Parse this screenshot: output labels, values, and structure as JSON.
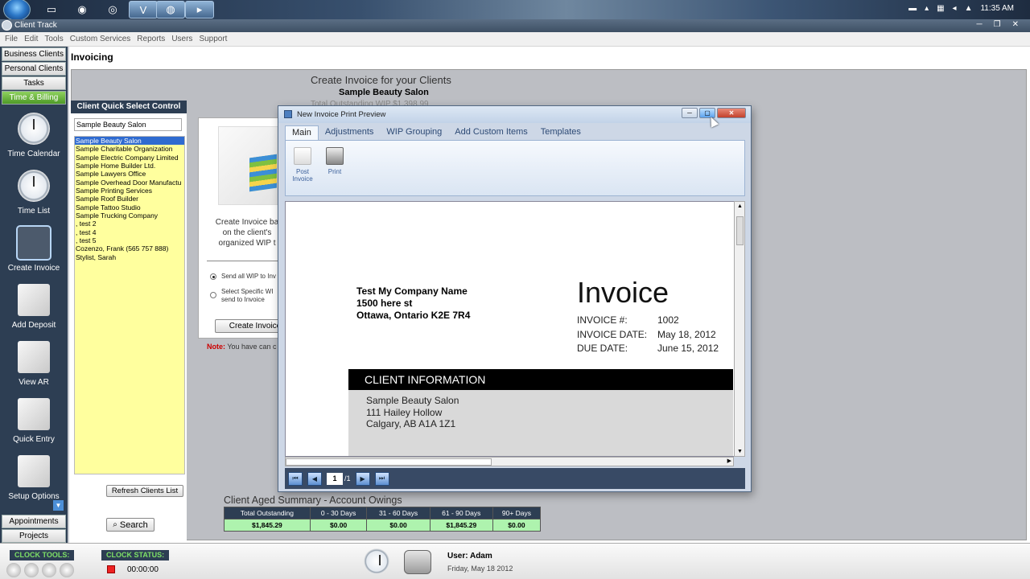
{
  "taskbar": {
    "time": "11:35 AM"
  },
  "app": {
    "title": "Client Track"
  },
  "menu": [
    "File",
    "Edit",
    "Tools",
    "Custom Services",
    "Reports",
    "Users",
    "Support"
  ],
  "nav": {
    "tabs": [
      "Business Clients",
      "Personal Clients",
      "Tasks",
      "Time & Billing"
    ],
    "items": [
      "Time Calendar",
      "Time List",
      "Create Invoice",
      "Add Deposit",
      "View AR",
      "Quick Entry",
      "Setup Options"
    ],
    "bottom_tabs": [
      "Appointments",
      "Projects"
    ]
  },
  "module": {
    "title": "Invoicing"
  },
  "quick_select": {
    "header": "Client Quick Select Control",
    "search_value": "Sample Beauty Salon",
    "clients": [
      "Sample Beauty Salon",
      "Sample Charitable Organization",
      "Sample Electric Company Limited",
      "Sample Home Builder Ltd.",
      "Sample Lawyers Office",
      "Sample Overhead Door Manufactu",
      "Sample Printing Services",
      "Sample Roof Builder",
      "Sample Tattoo Studio",
      "Sample Trucking Company",
      ", test 2",
      ", test 4",
      ", test 5",
      "Cozenzo, Frank (565 757 888)",
      "Stylist, Sarah"
    ],
    "refresh_label": "Refresh Clients List",
    "search_label": "Search"
  },
  "create": {
    "heading": "Create Invoice for your Clients",
    "client": "Sample Beauty Salon",
    "total_wip": "Total Outstanding WIP $1,398.99",
    "desc_lines": [
      "Create Invoice ba",
      "on the client's",
      "organized WIP t"
    ],
    "radio1_lines": [
      "Send all WIP to Inv"
    ],
    "radio2_lines": [
      "Select Specific WI",
      "send to Invoice"
    ],
    "create_btn": "Create Invoice",
    "note_label": "Note:",
    "note_text": "You have can c"
  },
  "aged": {
    "title": "Client Aged Summary - Account Owings",
    "headers": [
      "Total Outstanding",
      "0 - 30 Days",
      "31 - 60 Days",
      "61 - 90 Days",
      "90+ Days"
    ],
    "values": [
      "$1,845.29",
      "$0.00",
      "$0.00",
      "$1,845.29",
      "$0.00"
    ]
  },
  "status": {
    "clock_tools": "CLOCK TOOLS:",
    "clock_status": "CLOCK STATUS:",
    "timer": "00:00:00",
    "user": "User: Adam",
    "date": "Friday, May 18 2012"
  },
  "dialog": {
    "title": "New Invoice Print Preview",
    "tabs": [
      "Main",
      "Adjustments",
      "WIP Grouping",
      "Add Custom Items",
      "Templates"
    ],
    "post_label": "Post Invoice",
    "print_label": "Print",
    "page": "1",
    "page_total": "/1",
    "invoice": {
      "company": [
        "Test My Company Name",
        "1500 here st",
        "Ottawa, Ontario  K2E 7R4"
      ],
      "title": "Invoice",
      "number_label": "INVOICE #:",
      "number": "1002",
      "date_label": "INVOICE DATE:",
      "date": "May 18, 2012",
      "due_label": "DUE DATE:",
      "due": "June 15, 2012",
      "client_header": "CLIENT INFORMATION",
      "client": [
        "Sample Beauty Salon",
        "111 Hailey Hollow",
        "Calgary, AB  A1A 1Z1"
      ]
    }
  }
}
